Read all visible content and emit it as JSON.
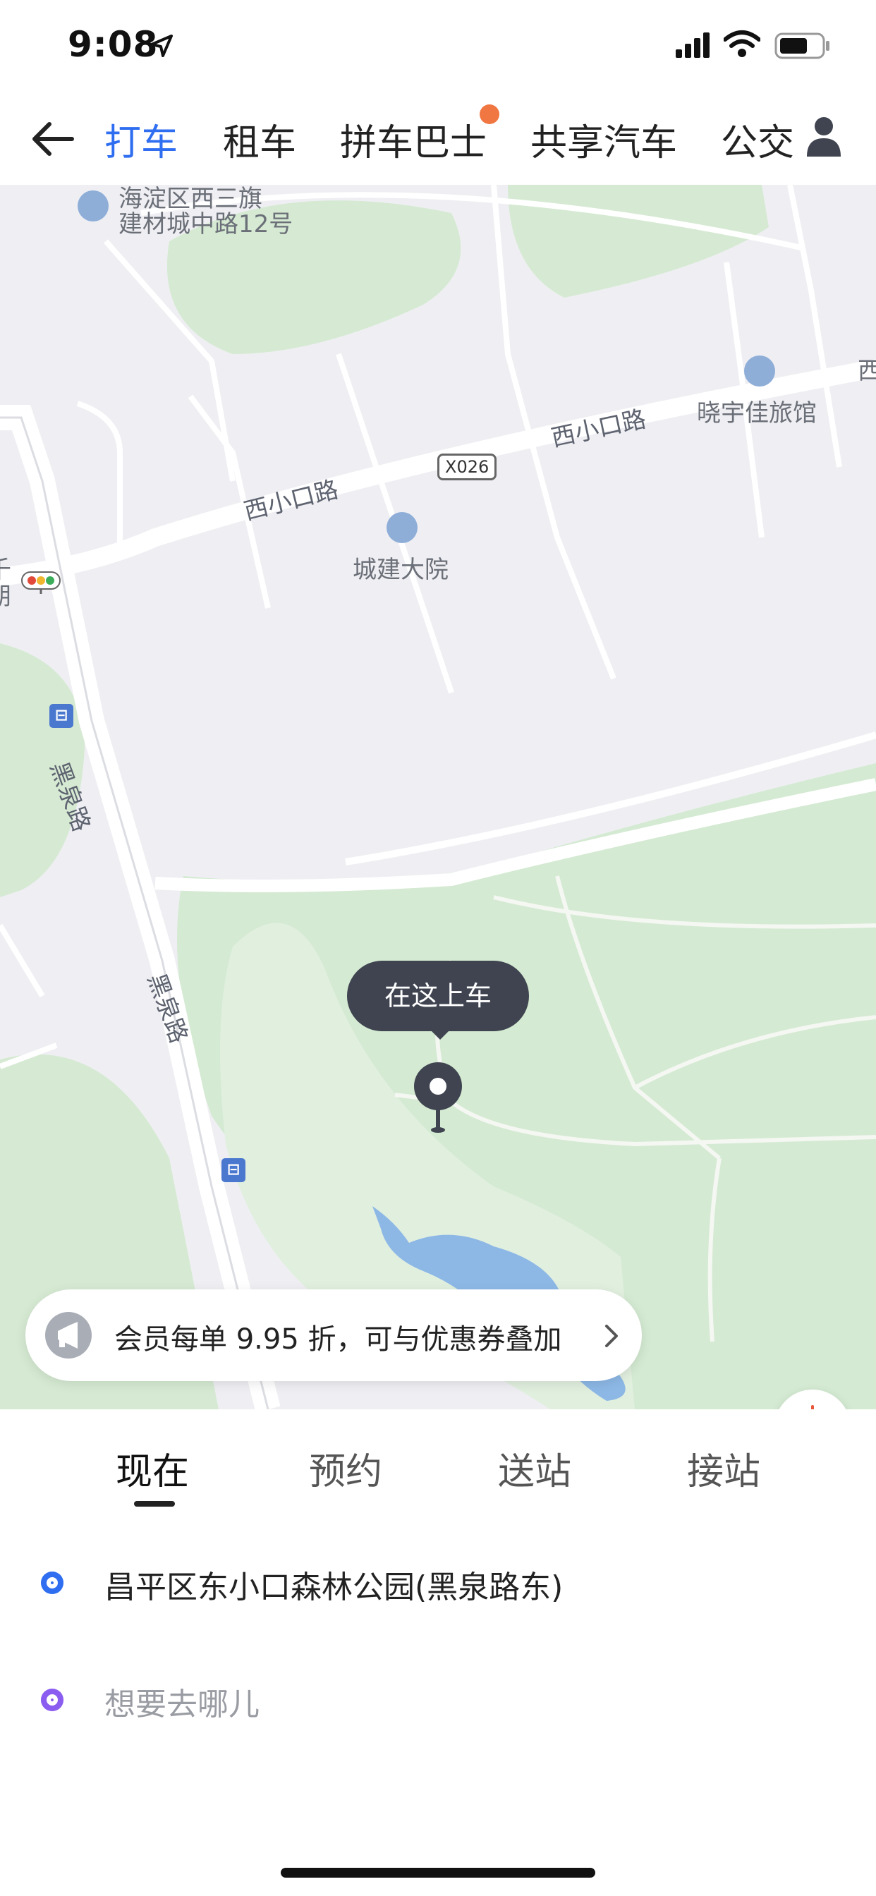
{
  "status_bar": {
    "time": "9:08"
  },
  "top_nav": {
    "tabs": [
      {
        "label": "打车",
        "active": true
      },
      {
        "label": "租车",
        "active": false
      },
      {
        "label": "拼车巴士",
        "active": false,
        "badge": true
      },
      {
        "label": "共享汽车",
        "active": false
      },
      {
        "label": "公交",
        "active": false
      }
    ]
  },
  "map": {
    "labels": {
      "poi_top_line1": "海淀区西三旗",
      "poi_top_line2": "建材城中路12号",
      "road_west_1": "西小口路",
      "road_west_2": "西小口路",
      "road_badge": "X026",
      "hotel": "晓宇佳旅馆",
      "compound": "城建大院",
      "road_heiquan_1": "黑泉路",
      "road_heiquan_2": "黑泉路",
      "edge_west": "西",
      "edge_left_1": "千",
      "edge_left_2": "朗"
    },
    "pickup_bubble": "在这上车",
    "promo_text": "会员每单 9.95 折，可与优惠券叠加"
  },
  "panel": {
    "modes": [
      {
        "label": "现在",
        "active": true
      },
      {
        "label": "预约",
        "active": false
      },
      {
        "label": "送站",
        "active": false
      },
      {
        "label": "接站",
        "active": false
      }
    ],
    "pickup_address": "昌平区东小口森林公园(黑泉路东)",
    "destination_placeholder": "想要去哪儿"
  },
  "colors": {
    "accent": "#2f6ef0",
    "badge": "#f07642",
    "alarm": "#e8573a",
    "pickup_dot": "#2f6ef0",
    "destination_dot": "#8b5cf0",
    "park": "#d4ead2",
    "water": "#8db8e6"
  }
}
